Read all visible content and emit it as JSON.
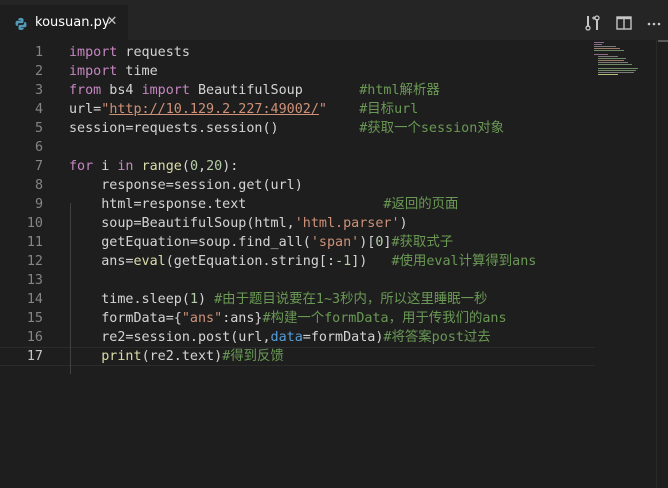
{
  "colors": {
    "background": "#1e1e1e",
    "tab_bar": "#252526",
    "line_number": "#858585",
    "keyword": "#c586c0",
    "builtin": "#569cd6",
    "string": "#ce9178",
    "number": "#b5cea8",
    "comment": "#6a9955",
    "function": "#dcdcaa"
  },
  "tab": {
    "label": "kousuan.py",
    "icon": "python-file-icon",
    "close_icon": "close-icon"
  },
  "actions": [
    {
      "name": "open-changes-icon"
    },
    {
      "name": "split-editor-icon"
    },
    {
      "name": "more-actions-icon"
    }
  ],
  "editor": {
    "active_line": 17,
    "lines": [
      {
        "n": "1",
        "tokens": [
          {
            "t": "import",
            "c": "kw"
          },
          {
            "t": " requests",
            "c": "txt"
          }
        ]
      },
      {
        "n": "2",
        "tokens": [
          {
            "t": "import",
            "c": "kw"
          },
          {
            "t": " time",
            "c": "txt"
          }
        ]
      },
      {
        "n": "3",
        "tokens": [
          {
            "t": "from",
            "c": "kw"
          },
          {
            "t": " bs4 ",
            "c": "txt"
          },
          {
            "t": "import",
            "c": "kw"
          },
          {
            "t": " BeautifulSoup       ",
            "c": "txt"
          },
          {
            "t": "#html解析器",
            "c": "cm"
          }
        ]
      },
      {
        "n": "4",
        "tokens": [
          {
            "t": "url=",
            "c": "txt"
          },
          {
            "t": "\"",
            "c": "str"
          },
          {
            "t": "http://10.129.2.227:49002/",
            "c": "url"
          },
          {
            "t": "\"",
            "c": "str"
          },
          {
            "t": "    ",
            "c": "txt"
          },
          {
            "t": "#目标url",
            "c": "cm"
          }
        ]
      },
      {
        "n": "5",
        "tokens": [
          {
            "t": "session=requests.session()          ",
            "c": "txt"
          },
          {
            "t": "#获取一个session对象",
            "c": "cm"
          }
        ]
      },
      {
        "n": "6",
        "tokens": []
      },
      {
        "n": "7",
        "tokens": [
          {
            "t": "for",
            "c": "kw"
          },
          {
            "t": " i ",
            "c": "txt"
          },
          {
            "t": "in",
            "c": "kw"
          },
          {
            "t": " ",
            "c": "txt"
          },
          {
            "t": "range",
            "c": "fn"
          },
          {
            "t": "(",
            "c": "txt"
          },
          {
            "t": "0",
            "c": "num"
          },
          {
            "t": ",",
            "c": "txt"
          },
          {
            "t": "20",
            "c": "num"
          },
          {
            "t": "):",
            "c": "txt"
          }
        ]
      },
      {
        "n": "8",
        "tokens": [
          {
            "t": "    response=session.get(url)",
            "c": "txt"
          }
        ]
      },
      {
        "n": "9",
        "tokens": [
          {
            "t": "    html=response.text                 ",
            "c": "txt"
          },
          {
            "t": "#返回的页面",
            "c": "cm"
          }
        ]
      },
      {
        "n": "10",
        "tokens": [
          {
            "t": "    soup=BeautifulSoup(html,",
            "c": "txt"
          },
          {
            "t": "'html.parser'",
            "c": "str"
          },
          {
            "t": ")",
            "c": "txt"
          }
        ]
      },
      {
        "n": "11",
        "tokens": [
          {
            "t": "    getEquation=soup.find_all(",
            "c": "txt"
          },
          {
            "t": "'span'",
            "c": "str"
          },
          {
            "t": ")[",
            "c": "txt"
          },
          {
            "t": "0",
            "c": "num"
          },
          {
            "t": "]",
            "c": "txt"
          },
          {
            "t": "#获取式子",
            "c": "cm"
          }
        ]
      },
      {
        "n": "12",
        "tokens": [
          {
            "t": "    ans=",
            "c": "txt"
          },
          {
            "t": "eval",
            "c": "fn"
          },
          {
            "t": "(getEquation.string[:",
            "c": "txt"
          },
          {
            "t": "-1",
            "c": "num"
          },
          {
            "t": "])   ",
            "c": "txt"
          },
          {
            "t": "#使用eval计算得到ans",
            "c": "cm"
          }
        ]
      },
      {
        "n": "13",
        "tokens": []
      },
      {
        "n": "14",
        "tokens": [
          {
            "t": "    time.sleep(",
            "c": "txt"
          },
          {
            "t": "1",
            "c": "num"
          },
          {
            "t": ") ",
            "c": "txt"
          },
          {
            "t": "#由于题目说要在1~3秒内，所以这里睡眠一秒",
            "c": "cm"
          }
        ]
      },
      {
        "n": "15",
        "tokens": [
          {
            "t": "    formData={",
            "c": "txt"
          },
          {
            "t": "\"ans\"",
            "c": "str"
          },
          {
            "t": ":ans}",
            "c": "txt"
          },
          {
            "t": "#构建一个formData，用于传我们的ans",
            "c": "cm"
          }
        ]
      },
      {
        "n": "16",
        "tokens": [
          {
            "t": "    re2=session.post(url,",
            "c": "txt"
          },
          {
            "t": "data",
            "c": "bl"
          },
          {
            "t": "=formData)",
            "c": "txt"
          },
          {
            "t": "#将答案post过去",
            "c": "cm"
          }
        ]
      },
      {
        "n": "17",
        "tokens": [
          {
            "t": "    ",
            "c": "txt"
          },
          {
            "t": "print",
            "c": "fn"
          },
          {
            "t": "(re2.text)",
            "c": "txt"
          },
          {
            "t": "#得到反馈",
            "c": "cm"
          }
        ]
      }
    ]
  }
}
